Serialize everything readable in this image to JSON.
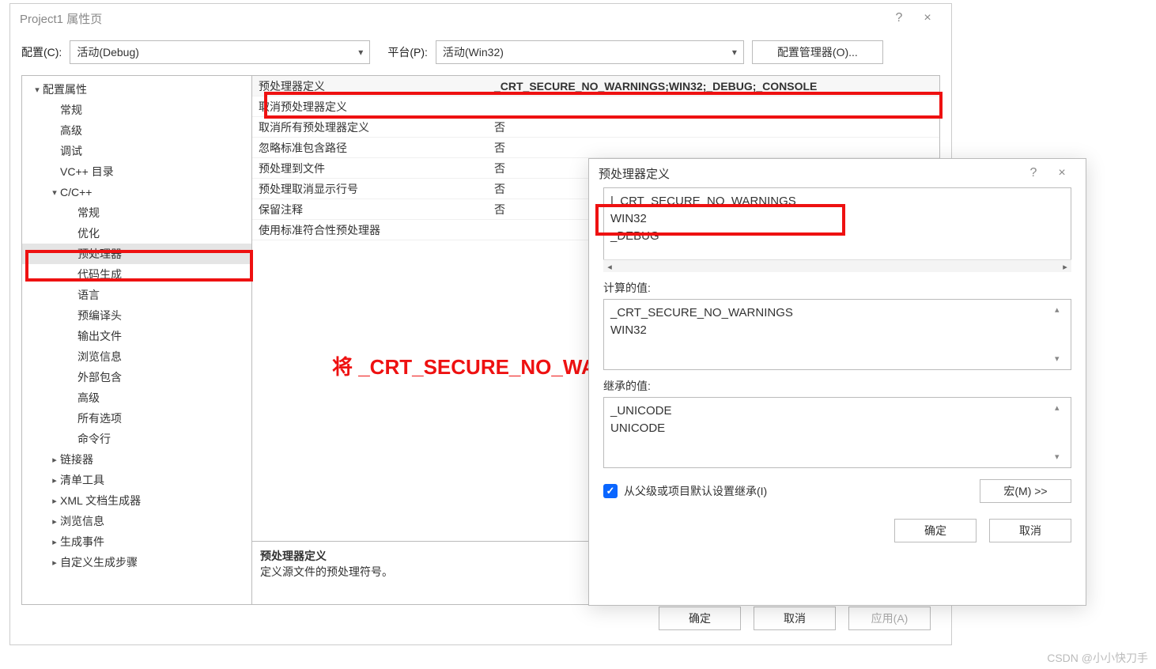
{
  "mainWindow": {
    "title": "Project1 属性页",
    "help": "?",
    "close": "×"
  },
  "configRow": {
    "configLabel": "配置(C):",
    "configValue": "活动(Debug)",
    "platformLabel": "平台(P):",
    "platformValue": "活动(Win32)",
    "managerBtn": "配置管理器(O)..."
  },
  "tree": [
    {
      "label": "配置属性",
      "indent": 0,
      "exp": "▾"
    },
    {
      "label": "常规",
      "indent": 1
    },
    {
      "label": "高级",
      "indent": 1
    },
    {
      "label": "调试",
      "indent": 1
    },
    {
      "label": "VC++ 目录",
      "indent": 1
    },
    {
      "label": "C/C++",
      "indent": 1,
      "exp": "▾"
    },
    {
      "label": "常规",
      "indent": 2
    },
    {
      "label": "优化",
      "indent": 2
    },
    {
      "label": "预处理器",
      "indent": 2,
      "sel": true
    },
    {
      "label": "代码生成",
      "indent": 2
    },
    {
      "label": "语言",
      "indent": 2
    },
    {
      "label": "预编译头",
      "indent": 2
    },
    {
      "label": "输出文件",
      "indent": 2
    },
    {
      "label": "浏览信息",
      "indent": 2
    },
    {
      "label": "外部包含",
      "indent": 2
    },
    {
      "label": "高级",
      "indent": 2
    },
    {
      "label": "所有选项",
      "indent": 2
    },
    {
      "label": "命令行",
      "indent": 2
    },
    {
      "label": "链接器",
      "indent": 1,
      "exp": "▸"
    },
    {
      "label": "清单工具",
      "indent": 1,
      "exp": "▸"
    },
    {
      "label": "XML 文档生成器",
      "indent": 1,
      "exp": "▸"
    },
    {
      "label": "浏览信息",
      "indent": 1,
      "exp": "▸"
    },
    {
      "label": "生成事件",
      "indent": 1,
      "exp": "▸"
    },
    {
      "label": "自定义生成步骤",
      "indent": 1,
      "exp": "▸"
    }
  ],
  "props": [
    {
      "k": "预处理器定义",
      "v": "_CRT_SECURE_NO_WARNINGS;WIN32;_DEBUG;_CONSOLE",
      "first": true
    },
    {
      "k": "取消预处理器定义",
      "v": ""
    },
    {
      "k": "取消所有预处理器定义",
      "v": "否"
    },
    {
      "k": "忽略标准包含路径",
      "v": "否"
    },
    {
      "k": "预处理到文件",
      "v": "否"
    },
    {
      "k": "预处理取消显示行号",
      "v": "否"
    },
    {
      "k": "保留注释",
      "v": "否"
    },
    {
      "k": "使用标准符合性预处理器",
      "v": ""
    }
  ],
  "desc": {
    "title": "预处理器定义",
    "body": "定义源文件的预处理符号。"
  },
  "mainBtns": {
    "ok": "确定",
    "cancel": "取消",
    "apply": "应用(A)"
  },
  "popup": {
    "title": "预处理器定义",
    "help": "?",
    "close": "×",
    "editLines": "|_CRT_SECURE_NO_WARNINGS\nWIN32\n_DEBUG",
    "computedLabel": "计算的值:",
    "computedLines": "_CRT_SECURE_NO_WARNINGS\nWIN32",
    "inheritedLabel": "继承的值:",
    "inheritedLines": "_UNICODE\nUNICODE",
    "inheritCheck": "从父级或项目默认设置继承(I)",
    "macroBtn": "宏(M) >>",
    "ok": "确定",
    "cancel": "取消"
  },
  "annotation": "将 _CRT_SECURE_NO_WARNINGS添加至预处理器定义",
  "watermark": "CSDN @小小快刀手"
}
